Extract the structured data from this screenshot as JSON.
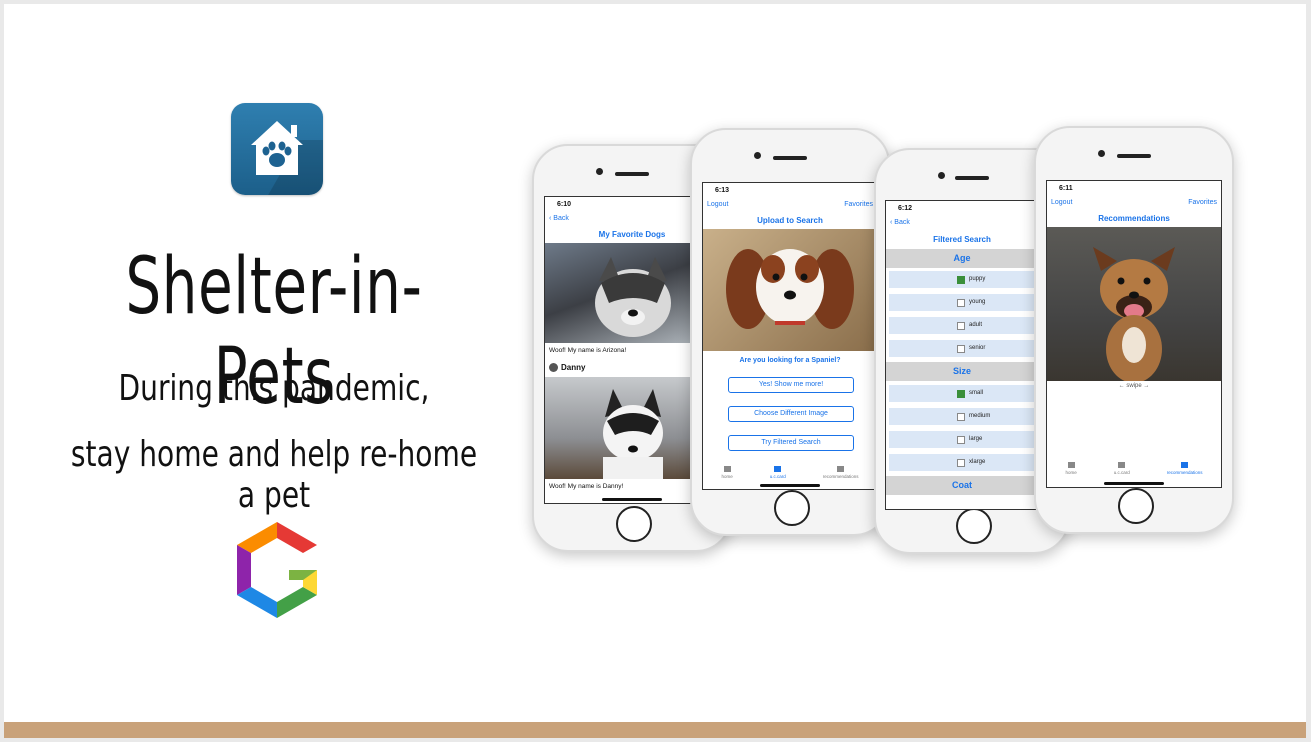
{
  "app": {
    "title": "Shelter-in-Pets",
    "subtitle_line1": "During this pandemic,",
    "subtitle_line2": "stay home and help re-home a pet",
    "icon": "paw-house-icon",
    "partner_logo": "hexagon-g-logo",
    "accent_color": "#1a73e8",
    "bottom_bar_color": "#c9a27a"
  },
  "phone1": {
    "time": "6:10",
    "back_label": "Back",
    "title": "My Favorite Dogs",
    "dog1_caption": "Woof! My name is Arizona!",
    "dog2_name": "Danny",
    "dog2_caption": "Woof! My name is Danny!"
  },
  "phone2": {
    "time": "6:13",
    "logout_label": "Logout",
    "favorites_label": "Favorites",
    "title": "Upload to Search",
    "question": "Are you looking for a Spaniel?",
    "btn_yes": "Yes! Show me more!",
    "btn_choose": "Choose Different Image",
    "btn_filtered": "Try Filtered Search",
    "tabs": [
      "home",
      "u.c.card",
      "recommendations"
    ]
  },
  "phone3": {
    "time": "6:12",
    "back_label": "Back",
    "title": "Filtered Search",
    "section_age": "Age",
    "age_options": [
      "puppy",
      "young",
      "adult",
      "senior"
    ],
    "section_size": "Size",
    "size_options": [
      "small",
      "medium",
      "large",
      "xlarge"
    ],
    "section_coat": "Coat"
  },
  "phone4": {
    "time": "6:11",
    "logout_label": "Logout",
    "favorites_label": "Favorites",
    "title": "Recommendations",
    "swipe_hint": "← swipe →",
    "tabs": [
      "home",
      "u.c.card",
      "recommendations"
    ]
  }
}
